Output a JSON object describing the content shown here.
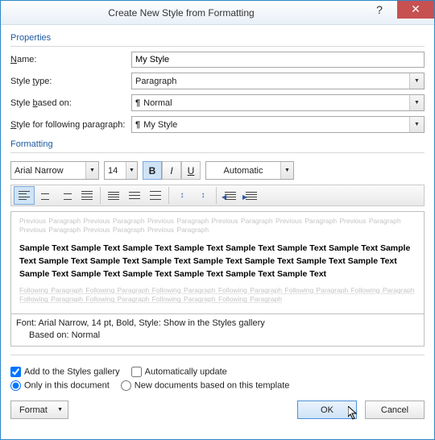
{
  "title": "Create New Style from Formatting",
  "properties": {
    "heading": "Properties",
    "name_label_pre": "",
    "name_ul": "N",
    "name_label_post": "ame:",
    "name_value": "My Style",
    "type_label_pre": "Style ",
    "type_ul": "t",
    "type_label_post": "ype:",
    "type_value": "Paragraph",
    "based_label_pre": "Style ",
    "based_ul": "b",
    "based_label_post": "ased on:",
    "based_value": "Normal",
    "follow_label_pre": "",
    "follow_ul": "S",
    "follow_label_post": "tyle for following paragraph:",
    "follow_value": "My Style"
  },
  "formatting": {
    "heading": "Formatting",
    "font": "Arial Narrow",
    "size": "14",
    "bold_active": true,
    "italic_active": false,
    "underline_active": false,
    "color": "Automatic",
    "align_active": "left"
  },
  "preview": {
    "ghost_prev": "Previous Paragraph Previous Paragraph Previous Paragraph Previous Paragraph Previous Paragraph Previous Paragraph Previous Paragraph Previous Paragraph Previous Paragraph",
    "sample": "Sample Text Sample Text Sample Text Sample Text Sample Text Sample Text Sample Text Sample Text Sample Text Sample Text Sample Text Sample Text Sample Text Sample Text Sample Text Sample Text Sample Text Sample Text Sample Text Sample Text Sample Text",
    "ghost_next": "Following Paragraph Following Paragraph Following Paragraph Following Paragraph Following Paragraph Following Paragraph Following Paragraph Following Paragraph Following Paragraph Following Paragraph"
  },
  "description": {
    "line1": "Font: Arial Narrow, 14 pt, Bold, Style: Show in the Styles gallery",
    "line2": "Based on: Normal"
  },
  "options": {
    "add_gallery_pre": "Add to the ",
    "add_gallery_ul": "S",
    "add_gallery_post": "tyles gallery",
    "add_gallery_checked": true,
    "auto_update_pre": "A",
    "auto_update_ul": "u",
    "auto_update_post": "tomatically update",
    "auto_update_checked": false,
    "only_doc_pre": "Only in this ",
    "only_doc_ul": "d",
    "only_doc_post": "ocument",
    "new_tpl": "New documents based on this template",
    "scope": "document"
  },
  "buttons": {
    "format_pre": "F",
    "format_ul": "o",
    "format_post": "rmat",
    "ok": "OK",
    "cancel": "Cancel"
  }
}
